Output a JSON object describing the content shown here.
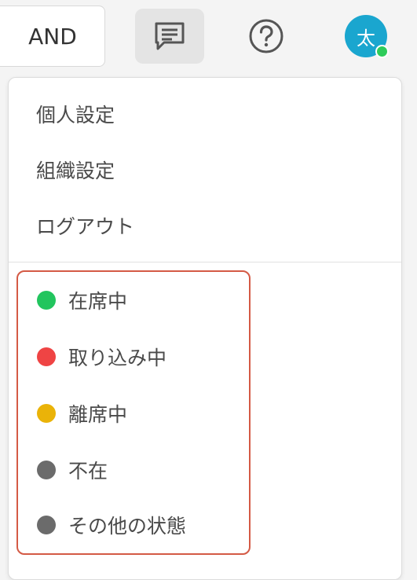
{
  "header": {
    "and_label": "AND",
    "avatar_initial": "太",
    "avatar_color": "#1aa6cf",
    "avatar_status_color": "#2ecc5a",
    "chat_icon": "chat-icon",
    "help_icon": "help-icon"
  },
  "menu": {
    "items": [
      {
        "label": "個人設定"
      },
      {
        "label": "組織設定"
      },
      {
        "label": "ログアウト"
      }
    ]
  },
  "statuses": [
    {
      "label": "在席中",
      "color": "#22c55e"
    },
    {
      "label": "取り込み中",
      "color": "#ef4444"
    },
    {
      "label": "離席中",
      "color": "#eab308"
    },
    {
      "label": "不在",
      "color": "#6b6b6b"
    },
    {
      "label": "その他の状態",
      "color": "#6b6b6b"
    }
  ],
  "highlight_color": "#d45a45"
}
